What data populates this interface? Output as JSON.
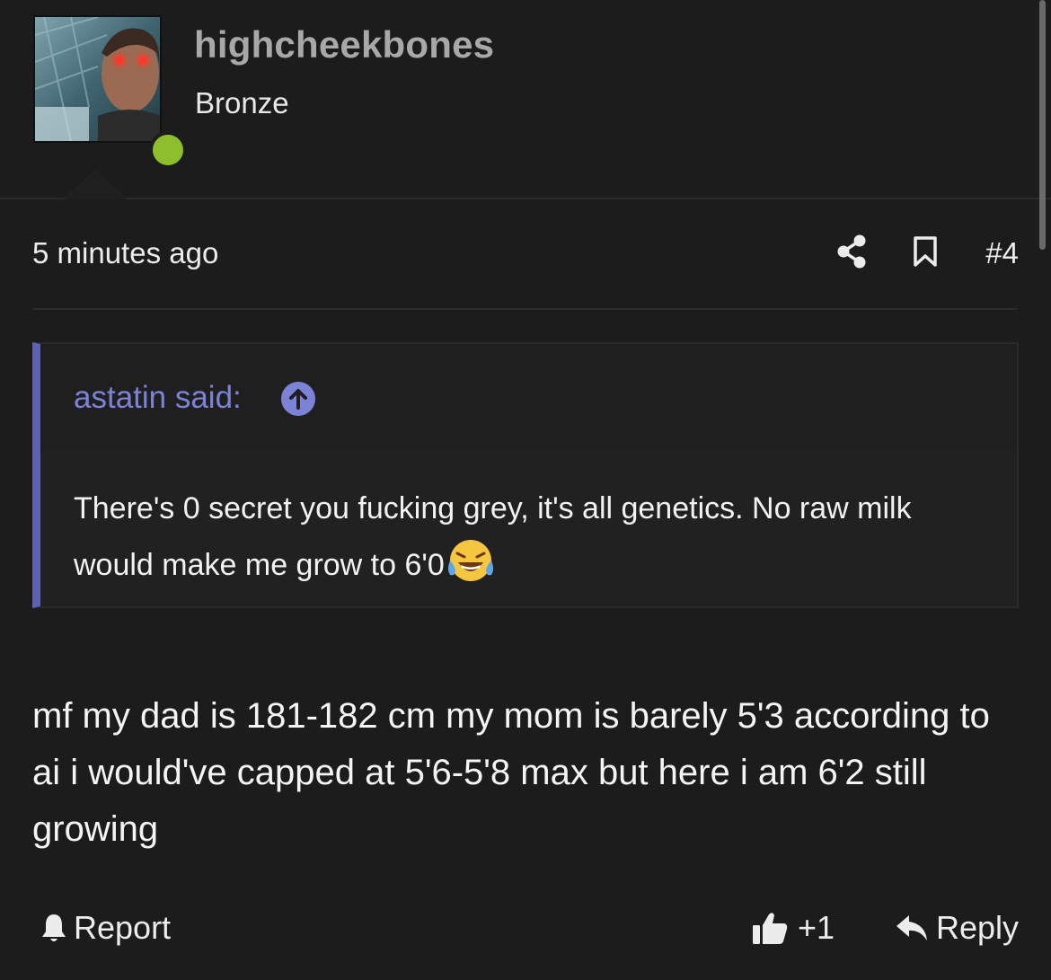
{
  "user": {
    "username": "highcheekbones",
    "title": "Bronze",
    "status_color": "#8dbf2c"
  },
  "post": {
    "time": "5 minutes ago",
    "number": "#4",
    "body": "mf my dad is 181-182 cm my mom is barely 5'3 according to ai i would've capped at 5'6-5'8 max but here i am 6'2 still growing"
  },
  "quote": {
    "author_label": "astatin said:",
    "text": "There's 0 secret you fucking grey, it's all genetics. No raw milk would make me grow to 6'0",
    "emoji": "laughing-crying-emoji",
    "accent_color": "#5c62b0"
  },
  "footer": {
    "report_label": "Report",
    "like_count": "+1",
    "reply_label": "Reply"
  },
  "icons": {
    "share": "share-icon",
    "bookmark": "bookmark-icon",
    "report": "bell-icon",
    "like": "thumbs-up-icon",
    "reply": "reply-arrow-icon",
    "quote_expand": "arrow-up-circle-icon"
  }
}
